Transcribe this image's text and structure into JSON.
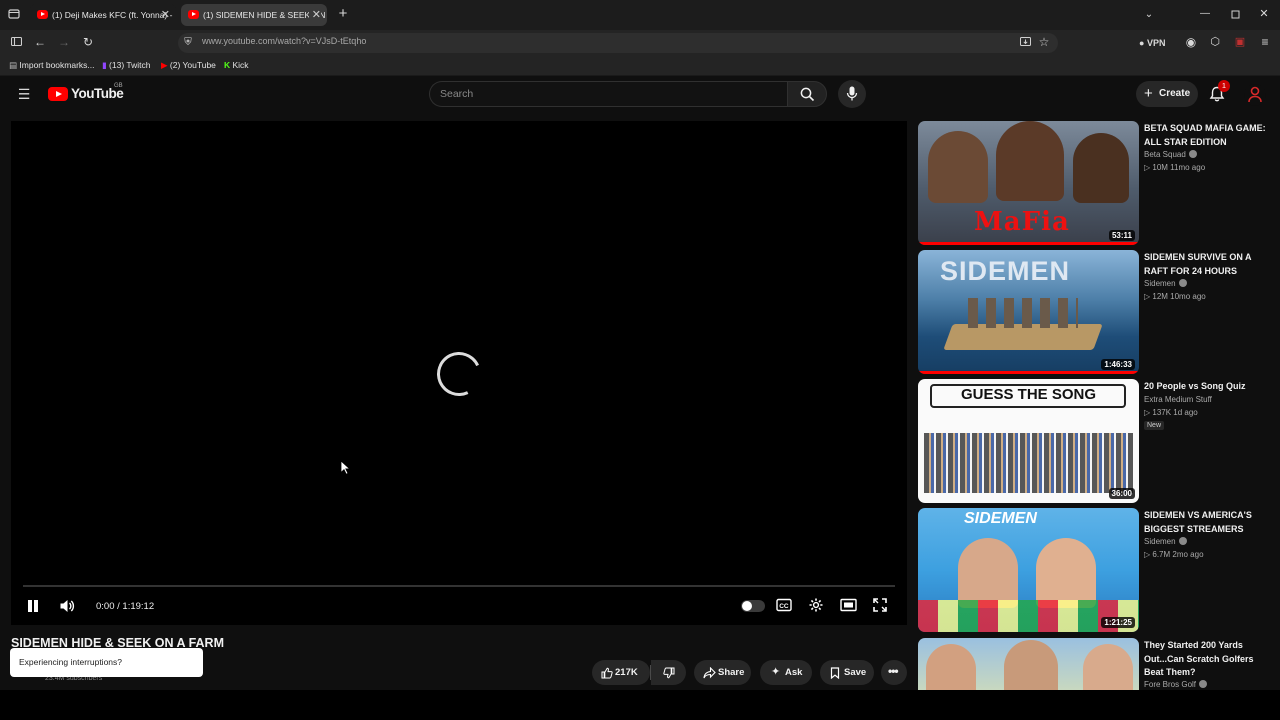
{
  "browser": {
    "tabs": [
      {
        "label": "(1) Deji Makes KFC (ft. Yonna) -"
      },
      {
        "label": "(1) SIDEMEN HIDE & SEEK ON A"
      }
    ],
    "url": "www.youtube.com/watch?v=VJsD-tEtqho",
    "vpn_label": "VPN",
    "bookmarks": [
      "Import bookmarks...",
      "(13) Twitch",
      "(2) YouTube",
      "Kick"
    ]
  },
  "youtube": {
    "logo_text": "YouTube",
    "country_code": "GB",
    "search_placeholder": "Search",
    "create_label": "Create",
    "notification_count": "1"
  },
  "player": {
    "time": "0:00 / 1:19:12",
    "progress": 0
  },
  "video": {
    "title": "SIDEMEN HIDE & SEEK ON A FARM",
    "toast": "Experiencing interruptions?",
    "subscribers": "23.4M subscribers",
    "likes": "217K",
    "share_label": "Share",
    "ask_label": "Ask",
    "save_label": "Save"
  },
  "sidebar": [
    {
      "title": "BETA SQUAD MAFIA GAME: ALL STAR EDITION",
      "channel": "Beta Squad",
      "meta": "10M  11mo ago",
      "duration": "53:11",
      "thumb_text": "MaFia",
      "badge": ""
    },
    {
      "title": "SIDEMEN SURVIVE ON A RAFT FOR 24 HOURS",
      "channel": "Sidemen",
      "meta": "12M  10mo ago",
      "duration": "1:46:33",
      "thumb_text": "SIDEMEN",
      "badge": ""
    },
    {
      "title": "20 People vs Song Quiz",
      "channel": "Extra Medium Stuff",
      "meta": "137K  1d ago",
      "duration": "36:00",
      "thumb_text": "GUESS THE SONG",
      "badge": "New"
    },
    {
      "title": "SIDEMEN VS AMERICA'S BIGGEST STREAMERS",
      "channel": "Sidemen",
      "meta": "6.7M  2mo ago",
      "duration": "1:21:25",
      "thumb_text": "SIDEMEN",
      "badge": ""
    },
    {
      "title": "They Started 200 Yards Out...Can Scratch Golfers Beat Them?",
      "channel": "Fore Bros Golf",
      "meta": "",
      "duration": "",
      "thumb_text": "",
      "badge": ""
    }
  ]
}
